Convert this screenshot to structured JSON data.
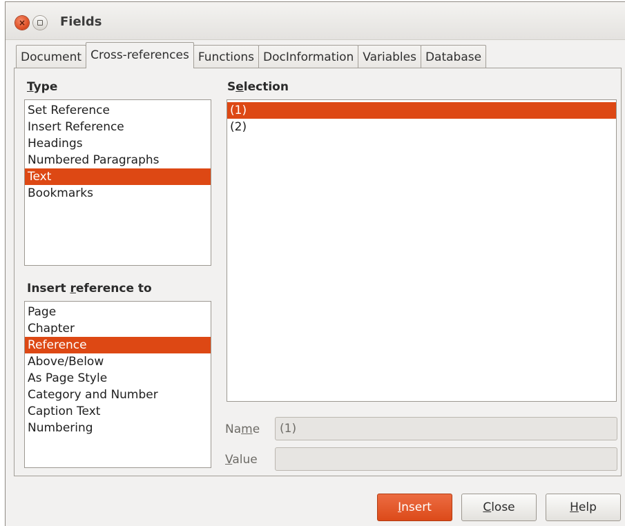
{
  "window": {
    "title": "Fields"
  },
  "tabs": [
    {
      "label": "Document"
    },
    {
      "label": "Cross-references",
      "active": true
    },
    {
      "label": "Functions"
    },
    {
      "label": "DocInformation"
    },
    {
      "label": "Variables"
    },
    {
      "label": "Database"
    }
  ],
  "type": {
    "label_mnemonic": "T",
    "label_rest": "ype",
    "items": [
      "Set Reference",
      "Insert Reference",
      "Headings",
      "Numbered Paragraphs",
      "Text",
      "Bookmarks"
    ],
    "selected": "Text"
  },
  "selection": {
    "label_pre": "S",
    "label_mnemonic": "e",
    "label_rest": "lection",
    "items": [
      "(1)",
      "(2)"
    ],
    "selected": "(1)"
  },
  "insert_reference_to": {
    "label_pre": "Insert ",
    "label_mnemonic": "r",
    "label_rest": "eference to",
    "items": [
      "Page",
      "Chapter",
      "Reference",
      "Above/Below",
      "As Page Style",
      "Category and Number",
      "Caption Text",
      "Numbering"
    ],
    "selected": "Reference"
  },
  "name_field": {
    "label_pre": "Na",
    "label_mnemonic": "m",
    "label_rest": "e",
    "value": "(1)"
  },
  "value_field": {
    "label_mnemonic": "V",
    "label_rest": "alue",
    "value": ""
  },
  "buttons": {
    "insert_mnemonic": "I",
    "insert_rest": "nsert",
    "close_mnemonic": "C",
    "close_rest": "lose",
    "help_mnemonic": "H",
    "help_rest": "elp"
  },
  "colors": {
    "accent": "#dd4814",
    "window_bg": "#f2f1f0"
  }
}
